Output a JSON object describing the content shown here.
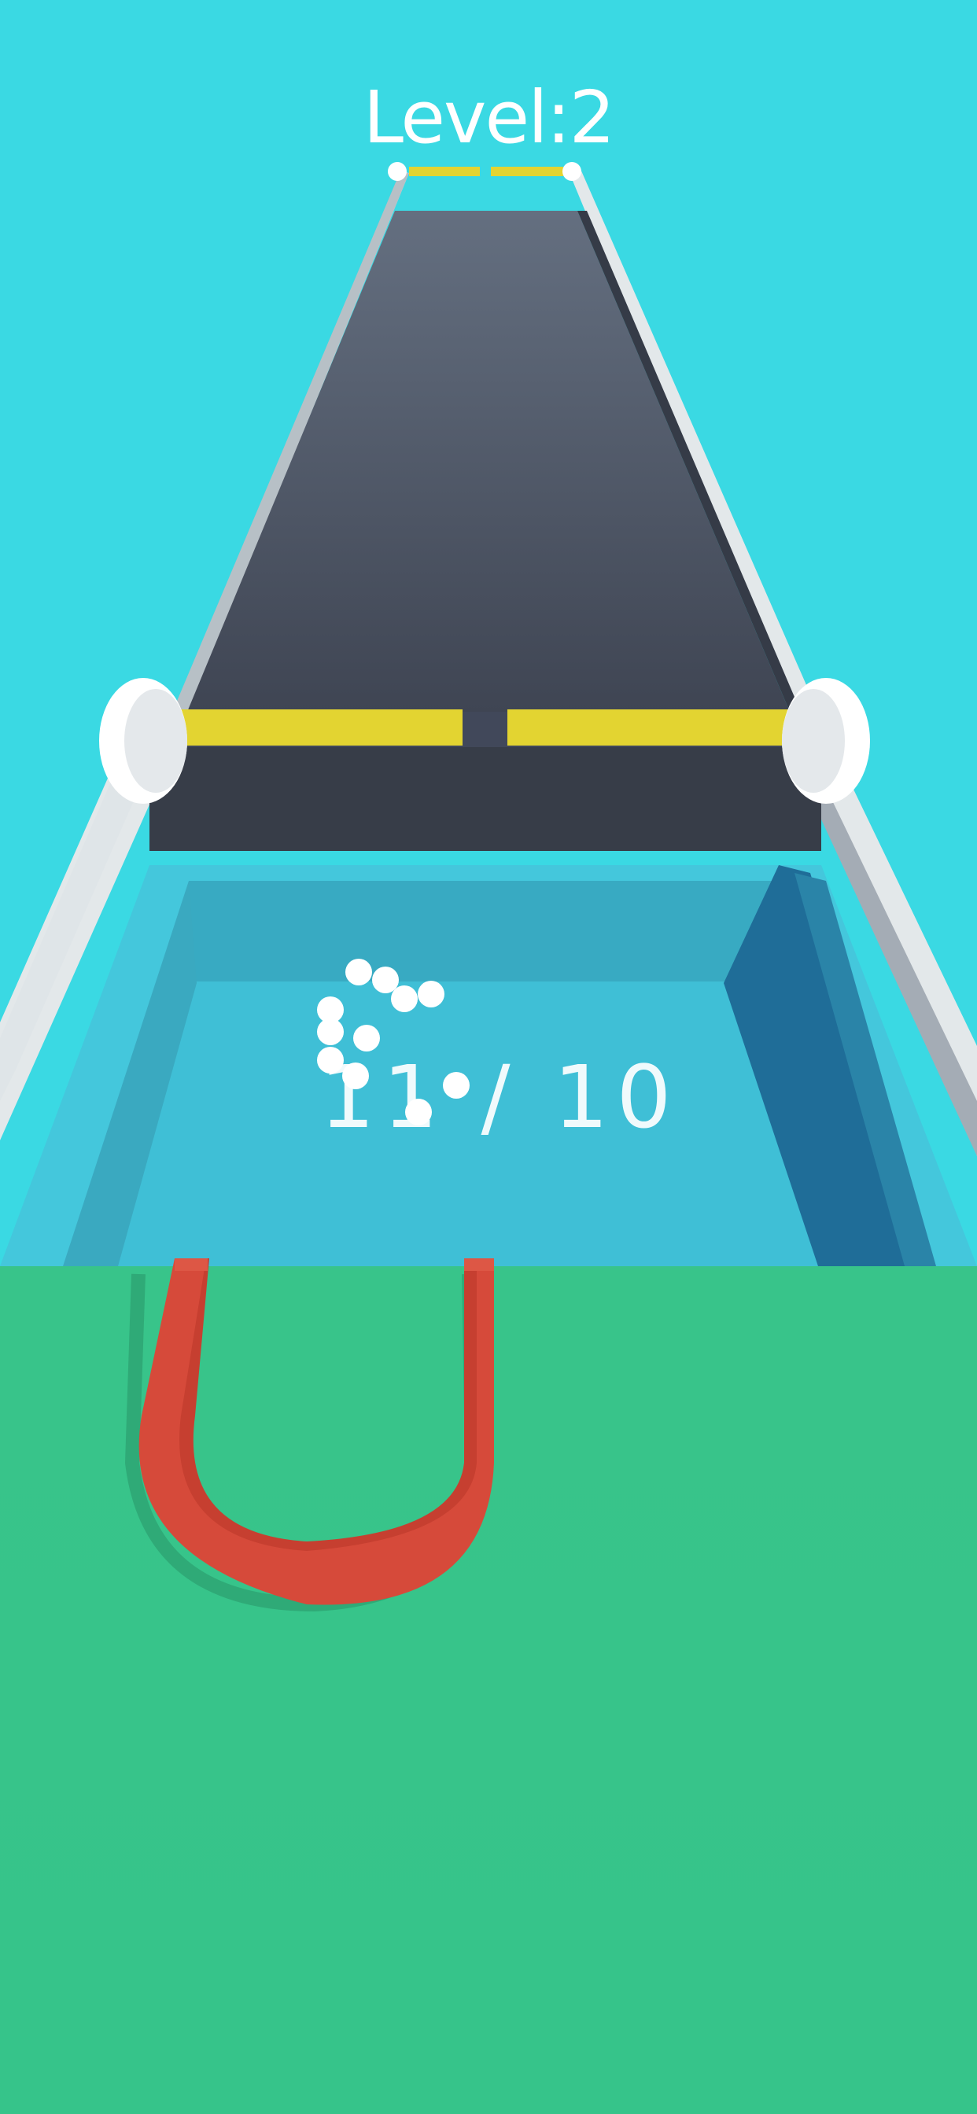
{
  "hud": {
    "level_label": "Level:2",
    "ball_counter": "11 / 10"
  },
  "colors": {
    "sky": "#3ad9e3",
    "track": "#4a5262",
    "rail": "#e9eef0",
    "gate": "#e3d431",
    "water": "#3fbfd6",
    "ground": "#38c48a",
    "magnet": "#d64a3a",
    "ball": "#ffffff"
  },
  "icons": {
    "magnet": "u-shaped-magnet-icon",
    "ball": "ball-icon"
  }
}
